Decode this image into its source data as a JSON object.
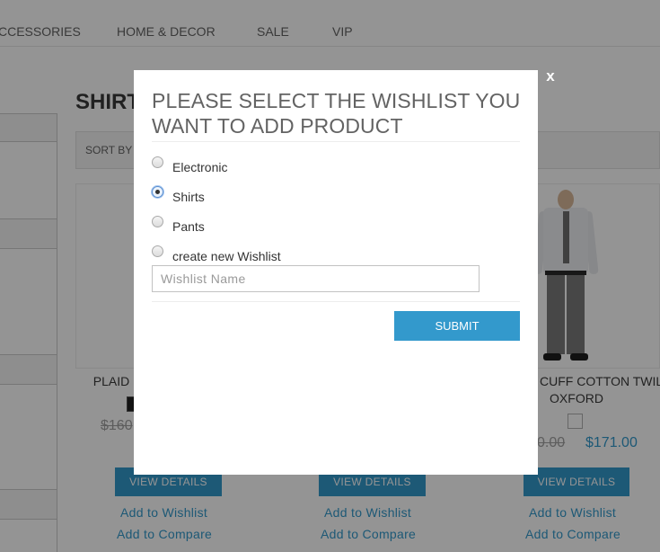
{
  "nav": {
    "items": [
      {
        "label": "CCESSORIES"
      },
      {
        "label": "HOME & DECOR"
      },
      {
        "label": "SALE"
      },
      {
        "label": "VIP"
      }
    ]
  },
  "category": {
    "title": "SHIRT",
    "sort_label": "SORT BY"
  },
  "products": [
    {
      "name": "PLAID",
      "old_price": "$160",
      "price": ""
    },
    {
      "name": "",
      "old_price": "",
      "price": ""
    },
    {
      "name_line1": "CUFF COTTON TWIL",
      "name_line2": "OXFORD",
      "old_price": "0.00",
      "price": "$171.00"
    }
  ],
  "actions": {
    "view_details": "VIEW DETAILS",
    "add_to_wishlist": "Add to Wishlist",
    "add_to_compare": "Add to Compare"
  },
  "modal": {
    "close_label": "x",
    "title": "PLEASE SELECT THE WISHLIST YOU WANT TO ADD PRODUCT",
    "options": [
      {
        "label": "Electronic",
        "checked": false
      },
      {
        "label": "Shirts",
        "checked": true
      },
      {
        "label": "Pants",
        "checked": false
      },
      {
        "label": "create new Wishlist",
        "checked": false
      }
    ],
    "input_placeholder": "Wishlist Name",
    "input_value": "",
    "submit_label": "SUBMIT"
  },
  "colors": {
    "accent": "#3399cc",
    "overlay": "rgba(0,0,0,0.42)"
  },
  "icons": {
    "close": "close-icon",
    "swatch": "color-swatch"
  }
}
